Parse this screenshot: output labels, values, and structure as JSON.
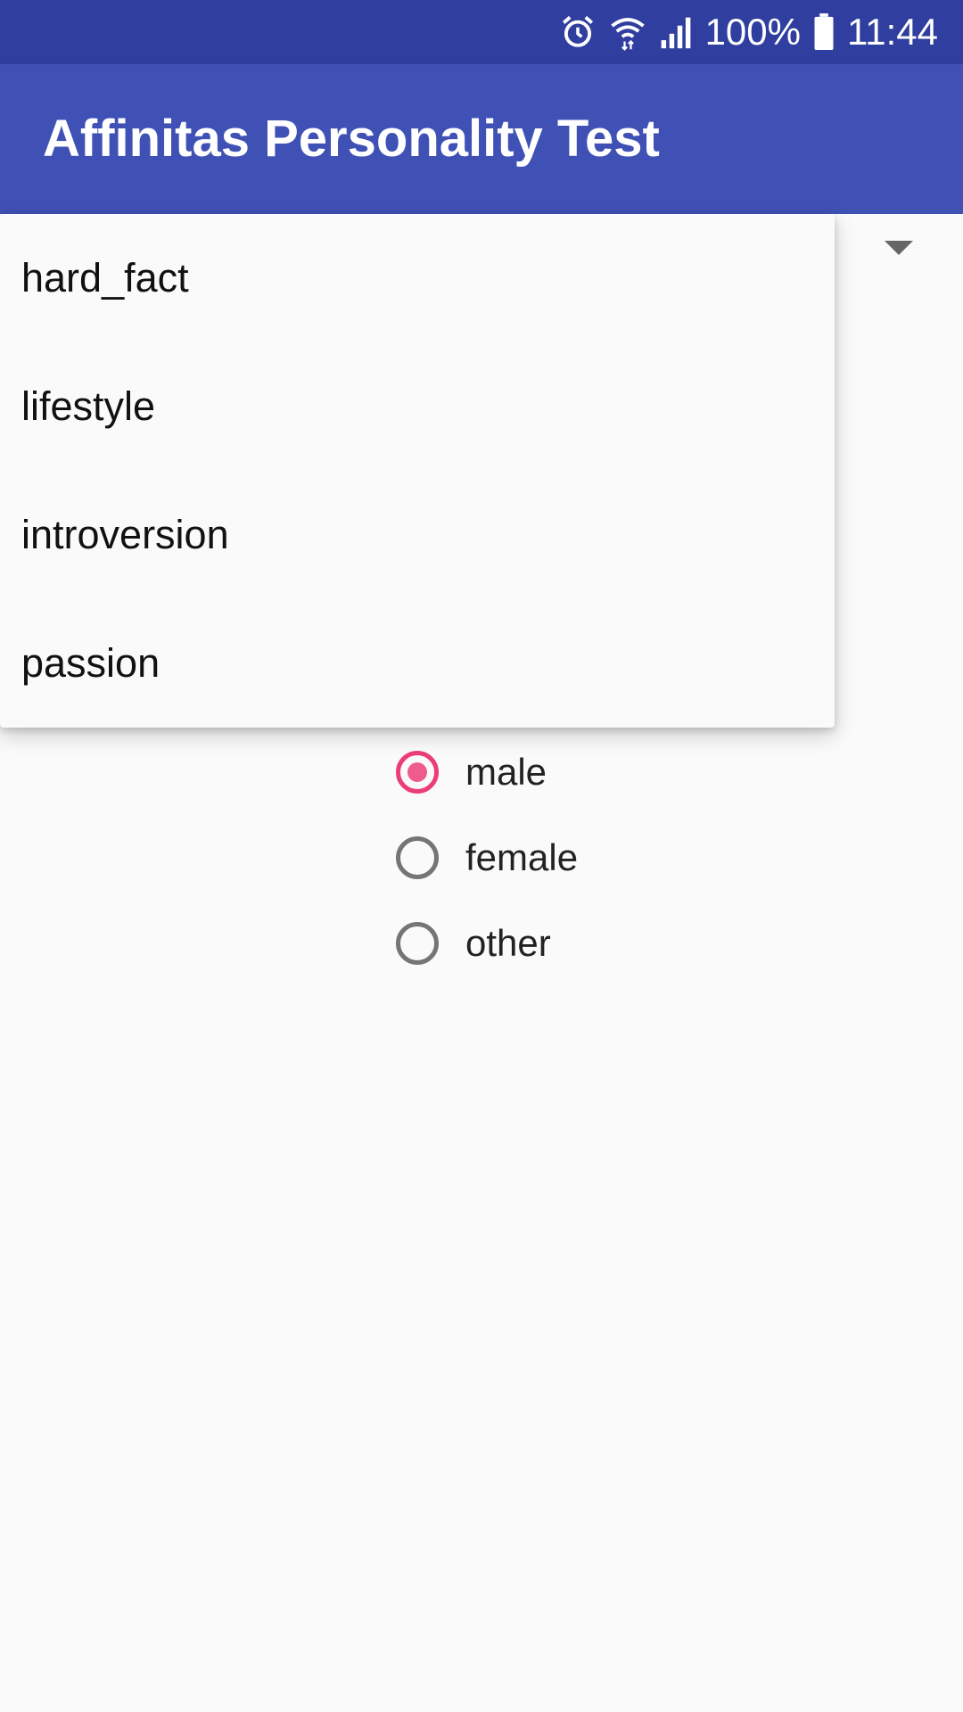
{
  "status_bar": {
    "icons": [
      "alarm-icon",
      "wifi-icon",
      "signal-icon",
      "battery-icon"
    ],
    "battery": "100%",
    "time": "11:44"
  },
  "app_bar": {
    "title": "Affinitas Personality Test"
  },
  "category_dropdown": {
    "options": [
      "hard_fact",
      "lifestyle",
      "introversion",
      "passion"
    ]
  },
  "gender_options": [
    {
      "label": "male",
      "checked": true
    },
    {
      "label": "female",
      "checked": false
    },
    {
      "label": "other",
      "checked": false
    }
  ],
  "colors": {
    "status_bar": "#303f9f",
    "app_bar": "#3f51b5",
    "accent": "#e91e63",
    "background": "#fafafa"
  }
}
